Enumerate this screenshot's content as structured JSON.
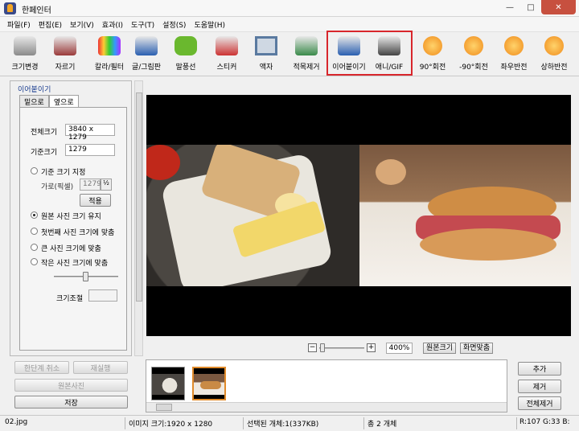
{
  "window": {
    "title": "한페인터",
    "minimize": "—",
    "maximize": "□",
    "close": "✕"
  },
  "menu": [
    "파일(F)",
    "편집(E)",
    "보기(V)",
    "효과(I)",
    "도구(T)",
    "설정(S)",
    "도움말(H)"
  ],
  "toolbar": [
    {
      "label": "크기변경",
      "icon": "resize-robot-icon"
    },
    {
      "label": "자르기",
      "icon": "crop-robot-icon"
    },
    {
      "label": "칼라/필터",
      "icon": "color-filter-robot-icon"
    },
    {
      "label": "글/그림판",
      "icon": "text-drawing-robot-icon"
    },
    {
      "label": "말풍선",
      "icon": "speech-bubble-icon"
    },
    {
      "label": "스티커",
      "icon": "sticker-robot-icon"
    },
    {
      "label": "액자",
      "icon": "frame-robot-icon"
    },
    {
      "label": "적목제거",
      "icon": "red-eye-robot-icon"
    },
    {
      "label": "이어붙이기",
      "icon": "merge-robot-icon"
    },
    {
      "label": "애니/GIF",
      "icon": "gif-robot-icon"
    },
    {
      "label": "90°회전",
      "icon": "rotate-cw-icon"
    },
    {
      "label": "-90°회전",
      "icon": "rotate-ccw-icon"
    },
    {
      "label": "좌우반전",
      "icon": "flip-horizontal-icon"
    },
    {
      "label": "상하반전",
      "icon": "flip-vertical-icon"
    }
  ],
  "panel": {
    "title": "이어붙이기",
    "tabs": [
      "밑으로",
      "옆으로"
    ],
    "total_size_label": "전체크기",
    "total_size_value": "3840 x 1279",
    "base_size_label": "기준크기",
    "base_size_value": "1279",
    "opt_base_size": "기준 크기 지정",
    "width_label": "가로(픽셀)",
    "width_value": "1279",
    "apply_button": "적용",
    "opt_keep_original": "원본 사진 크기 유지",
    "opt_fit_first": "첫번째 사진 크기에 맞춤",
    "opt_fit_large": "큰 사진 크기에 맞춤",
    "opt_fit_small": "작은 사진 크기에 맞춤",
    "size_adjust_label": "크기조절",
    "size_adjust_value": ""
  },
  "left_buttons": {
    "undo": "한단계 취소",
    "redo": "재실행",
    "original": "원본사진",
    "save": "저장"
  },
  "zoom": {
    "minus": "−",
    "plus": "+",
    "value": "400%",
    "original_size": "원본크기",
    "fit_screen": "화면맞춤"
  },
  "right_buttons": {
    "add": "추가",
    "remove": "제거",
    "remove_all": "전체제거"
  },
  "status": {
    "filename": "02.jpg",
    "image_size": "이미지 크기:1920 x 1280",
    "selected": "선택된 개체:1(337KB)",
    "total": "총 2 개체",
    "rgb": "R:107 G:33 B:"
  },
  "colors": {
    "highlight": "#d8262c",
    "panel_title": "#1a3d8f",
    "close_button": "#c7503f"
  }
}
